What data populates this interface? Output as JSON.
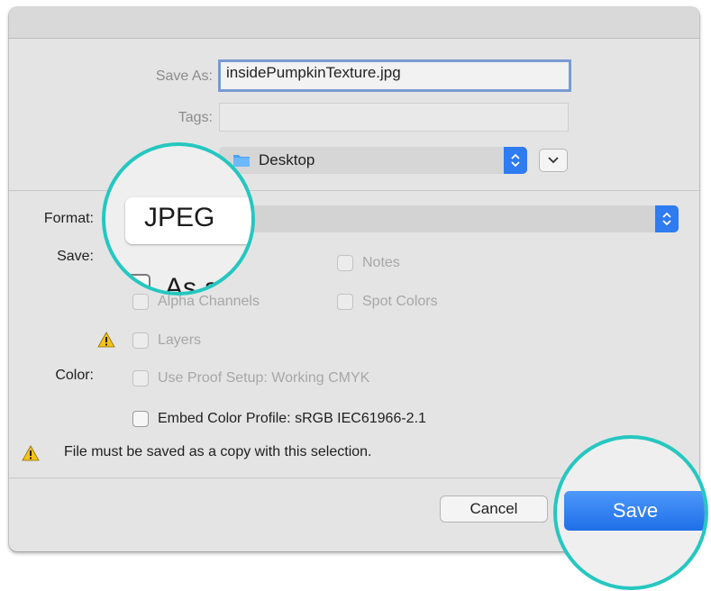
{
  "dialog": {
    "save_as_label": "Save As:",
    "save_as_value": "insidePumpkinTexture.jpg",
    "tags_label": "Tags:",
    "tags_value": "",
    "location": "Desktop",
    "format_label": "Format:",
    "format_value": "JPEG",
    "save_label": "Save:",
    "color_label": "Color:",
    "options": {
      "as_copy": "As a",
      "notes": "Notes",
      "alpha_channels": "Alpha Channels",
      "spot_colors": "Spot Colors",
      "layers": "Layers",
      "use_proof_setup": "Use Proof Setup:  Working CMYK",
      "embed_color_profile": "Embed Color Profile:  sRGB IEC61966-2.1"
    },
    "warning_message": "File must be saved as a copy with this selection.",
    "cancel_button": "Cancel",
    "save_button": "Save"
  },
  "icons": {
    "folder": "folder-icon",
    "stepper": "up-down-chevron-icon",
    "expand": "chevron-down-icon",
    "warning": "warning-triangle-icon"
  },
  "colors": {
    "accent_blue": "#2f7bf0",
    "highlight_ring": "#25c7c0",
    "warning_yellow": "#f5c21b"
  }
}
